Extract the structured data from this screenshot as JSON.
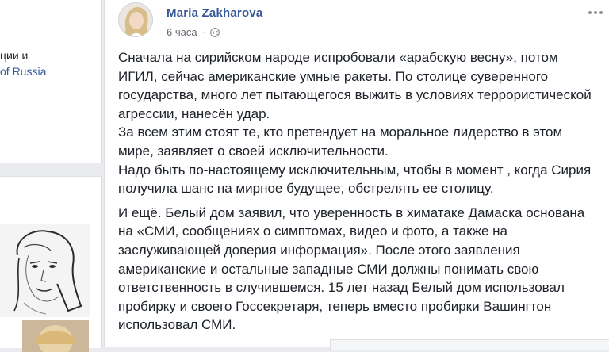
{
  "sidebar": {
    "text_line1": "ции и",
    "text_link": "of Russia"
  },
  "post": {
    "author": "Maria Zakharova",
    "time": "6 часа",
    "privacy_icon": "globe-icon",
    "more_icon": "more-options-icon",
    "paragraph1": "Сначала на сирийском народе испробовали «арабскую весну», потом\nИГИЛ, сейчас американские умные ракеты. По столице суверенного\nгосударства, много лет пытающегося выжить в условиях террористической\nагрессии, нанесён удар.\nЗа всем этим стоят те, кто претендует на моральное лидерство в этом\nмире, заявляет о своей исключительности.\nНадо быть по-настоящему исключительным, чтобы в момент , когда Сирия\nполучила шанс на мирное будущее, обстрелять ее столицу.",
    "paragraph2": "И ещё. Белый дом заявил, что уверенность в химатаке Дамаска основана\nна «СМИ, сообщениях о симптомах, видео и фото, а также на\nзаслуживающей доверия информация». После этого заявления\nамериканские и остальные западные СМИ должны понимать свою\nответственность в случившемся. 15 лет назад Белый дом использовал\nпробирку и своего Госсекретаря, теперь вместо пробирки Вашингтон\nиспользовал СМИ."
  },
  "colors": {
    "link": "#385898",
    "text": "#1d2129",
    "meta": "#616770",
    "background": "#e9ebee"
  }
}
